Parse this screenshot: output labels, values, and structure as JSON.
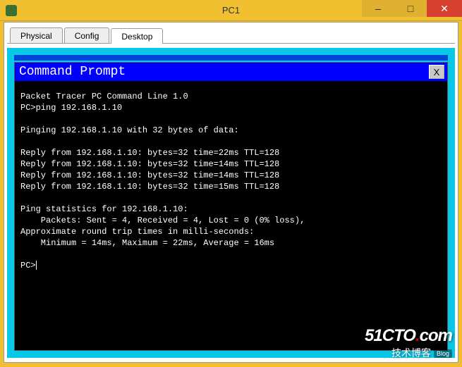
{
  "window": {
    "title": "PC1"
  },
  "tabs": {
    "physical": "Physical",
    "config": "Config",
    "desktop": "Desktop"
  },
  "cmd": {
    "title": "Command Prompt",
    "close": "X",
    "intro": "Packet Tracer PC Command Line 1.0",
    "prompt1": "PC>ping 192.168.1.10",
    "pinging": "Pinging 192.168.1.10 with 32 bytes of data:",
    "reply1": "Reply from 192.168.1.10: bytes=32 time=22ms TTL=128",
    "reply2": "Reply from 192.168.1.10: bytes=32 time=14ms TTL=128",
    "reply3": "Reply from 192.168.1.10: bytes=32 time=14ms TTL=128",
    "reply4": "Reply from 192.168.1.10: bytes=32 time=15ms TTL=128",
    "stats_hdr": "Ping statistics for 192.168.1.10:",
    "stats_pkts": "    Packets: Sent = 4, Received = 4, Lost = 0 (0% loss),",
    "stats_rtt_hdr": "Approximate round trip times in milli-seconds:",
    "stats_rtt": "    Minimum = 14ms, Maximum = 22ms, Average = 16ms",
    "prompt2": "PC>"
  },
  "watermark": {
    "brand_pre": "51CTO",
    "brand_dot": ".",
    "brand_post": "com",
    "sub": "技术博客",
    "badge": "Blog"
  }
}
